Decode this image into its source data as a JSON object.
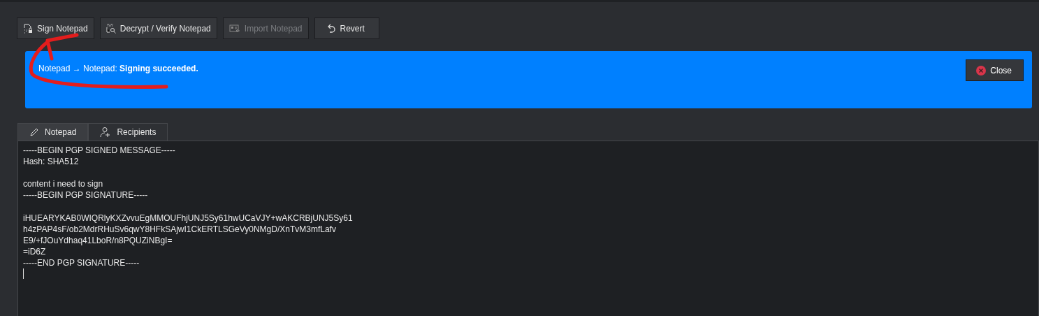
{
  "toolbar": [
    {
      "label": "Sign Notepad",
      "disabled": false
    },
    {
      "label": "Decrypt / Verify Notepad",
      "disabled": false
    },
    {
      "label": "Import Notepad",
      "disabled": true
    },
    {
      "label": "Revert",
      "disabled": false
    }
  ],
  "banner": {
    "message": "Notepad → Notepad: **Signing succeeded.**",
    "close_label": "Close"
  },
  "tabs": [
    {
      "label": "Notepad",
      "selected": true
    },
    {
      "label": "Recipients",
      "selected": false
    }
  ],
  "editor": {
    "paragraphs": [
      [
        "-----BEGIN PGP SIGNED MESSAGE-----",
        "Hash: SHA512"
      ],
      [
        "content i need to sign",
        "-----BEGIN PGP SIGNATURE-----"
      ],
      [
        "iHUEARYKAB0WIQRlyKXZvvuEgMMOUFhjUNJ5Sy61hwUCaVJY+wAKCRBjUNJ5Sy61",
        "h4zPAP4sF/ob2MdrRHuSv6qwY8HFkSAjwI1CkERTLSGeVy0NMgD/XnTvM3mfLafv",
        "E9/+fJOuYdhaq41LboR/n8PQUZiNBgI=",
        "=iD6Z",
        "-----END PGP SIGNATURE-----"
      ]
    ]
  }
}
